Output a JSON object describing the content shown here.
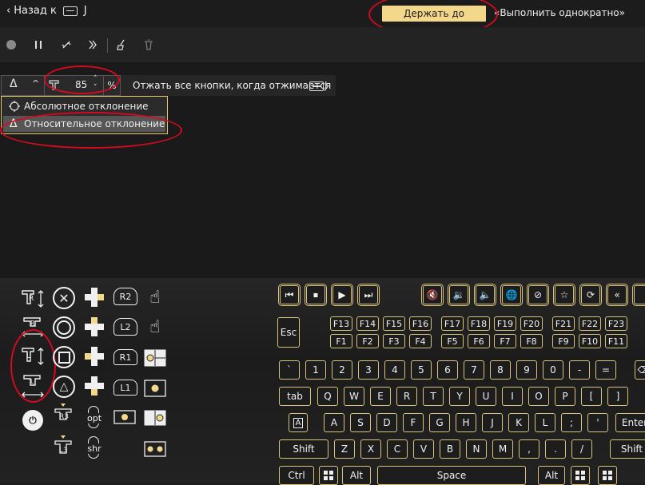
{
  "header": {
    "back_label": "Назад к",
    "key_suffix": "J",
    "hold_label": "Держать до отжатия",
    "once_label": "«Выполнить однократно»"
  },
  "toolbar": {
    "icons": [
      "record-icon",
      "pause-icon",
      "link-off-icon",
      "double-chevron-icon",
      "broom-icon",
      "trash-icon"
    ]
  },
  "options": {
    "deviation_symbol": "Δ",
    "value": "85",
    "unit": "%",
    "release_label": "Отжать все кнопки, когда отжимается",
    "release_key": "J"
  },
  "menu": {
    "items": [
      {
        "label": "Абсолютное отклонение",
        "icon": "crosshair-icon"
      },
      {
        "label": "Относительное отклонение",
        "icon": "delta-icon"
      }
    ]
  },
  "gamepad": {
    "labels": {
      "r2": "R2",
      "l2": "L2",
      "r1": "R1",
      "l1": "L1",
      "r3": "R3",
      "l3": "L3",
      "opt": "opt",
      "shr": "shr",
      "r": "R",
      "l": "L"
    }
  },
  "keyboard": {
    "media": [
      "⏮",
      "⏹",
      "▶",
      "⏭"
    ],
    "sys": [
      "🔇",
      "🔉",
      "🔈",
      "🌐",
      "⊘",
      "☆",
      "⟳",
      "«"
    ],
    "esc": "Esc",
    "f_top": [
      "F13",
      "F14",
      "F15",
      "F16",
      "F17",
      "F18",
      "F19",
      "F20",
      "F21",
      "F22",
      "F23"
    ],
    "f_bot": [
      "F1",
      "F2",
      "F3",
      "F4",
      "F5",
      "F6",
      "F7",
      "F8",
      "F9",
      "F10",
      "F11"
    ],
    "row1": [
      "`",
      "1",
      "2",
      "3",
      "4",
      "5",
      "6",
      "7",
      "8",
      "9",
      "0",
      "-",
      "="
    ],
    "row2": [
      "tab",
      "Q",
      "W",
      "E",
      "R",
      "T",
      "Y",
      "U",
      "I",
      "O",
      "P",
      "[",
      "]"
    ],
    "row3": [
      "A",
      "S",
      "D",
      "F",
      "G",
      "H",
      "J",
      "K",
      "L",
      ";",
      "'",
      "Enter"
    ],
    "caps": "A",
    "row4": [
      "Shift",
      "Z",
      "X",
      "C",
      "V",
      "B",
      "N",
      "M",
      ",",
      ".",
      "/",
      "Shift"
    ],
    "row5": [
      "Ctrl",
      "Alt",
      "Space",
      "Alt"
    ],
    "backspace": "⌫"
  }
}
